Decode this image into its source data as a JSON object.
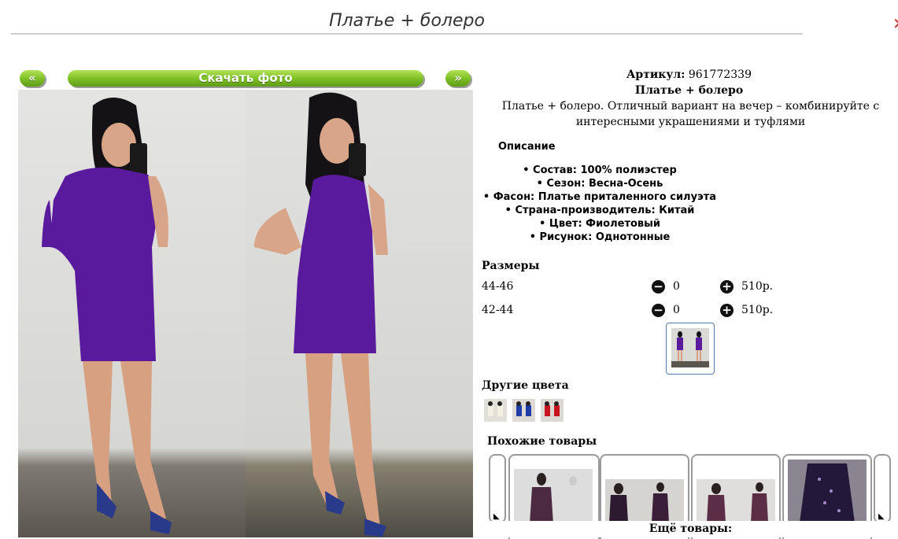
{
  "page": {
    "title": "Платье + болеро",
    "close_glyph": "✕"
  },
  "gallery": {
    "prev_label": "«",
    "next_label": "»",
    "download_label": "Скачать фото"
  },
  "product": {
    "articul_label": "Артикул:",
    "articul_value": "961772339",
    "name": "Платье + болеро",
    "description": "Платье + болеро. Отличный вариант на вечер – комбинируйте с интересными украшениями и туфлями"
  },
  "properties": {
    "heading": "Описание",
    "items": [
      "Состав: 100% полиэстер",
      "Сезон: Весна-Осень",
      "Фасон: Платье приталенного силуэта",
      "Страна-производитель: Китай",
      "Цвет: Фиолетовый",
      "Рисунок: Однотонные"
    ]
  },
  "sizes": {
    "heading": "Размеры",
    "rows": [
      {
        "size": "44-46",
        "qty": "0",
        "price": "510р."
      },
      {
        "size": "42-44",
        "qty": "0",
        "price": "510р."
      }
    ],
    "minus_glyph": "−",
    "plus_glyph": "+"
  },
  "other_colors": {
    "heading": "Другие цвета",
    "swatches": [
      "white-beige",
      "blue",
      "red"
    ]
  },
  "similar": {
    "heading": "Похожие товары",
    "more_label": "Ещё товары:",
    "scroll_left_glyph": "◣",
    "scroll_right_glyph": "◣"
  },
  "colors": {
    "accent_green": "#84c52a",
    "dress_purple": "#5a1a9e",
    "close_red": "#c0392b"
  }
}
